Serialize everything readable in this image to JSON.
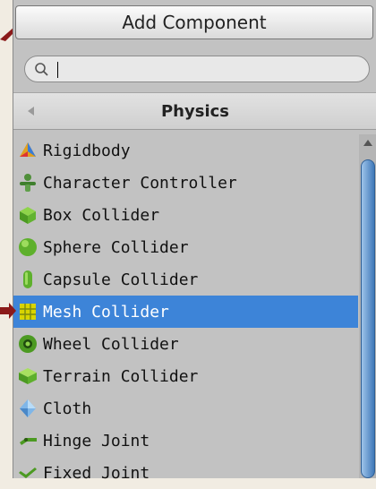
{
  "add_component": {
    "label": "Add Component"
  },
  "search": {
    "value": "",
    "placeholder": ""
  },
  "category": {
    "title": "Physics"
  },
  "items": [
    {
      "label": "Rigidbody",
      "icon": "rigidbody-icon"
    },
    {
      "label": "Character Controller",
      "icon": "character-controller-icon"
    },
    {
      "label": "Box Collider",
      "icon": "box-collider-icon"
    },
    {
      "label": "Sphere Collider",
      "icon": "sphere-collider-icon"
    },
    {
      "label": "Capsule Collider",
      "icon": "capsule-collider-icon"
    },
    {
      "label": "Mesh Collider",
      "icon": "mesh-collider-icon",
      "selected": true
    },
    {
      "label": "Wheel Collider",
      "icon": "wheel-collider-icon"
    },
    {
      "label": "Terrain Collider",
      "icon": "terrain-collider-icon"
    },
    {
      "label": "Cloth",
      "icon": "cloth-icon"
    },
    {
      "label": "Hinge Joint",
      "icon": "hinge-joint-icon"
    },
    {
      "label": "Fixed Joint",
      "icon": "fixed-joint-icon"
    }
  ],
  "colors": {
    "selection": "#3d84d8",
    "annotation_arrow": "#8b1a1a"
  }
}
